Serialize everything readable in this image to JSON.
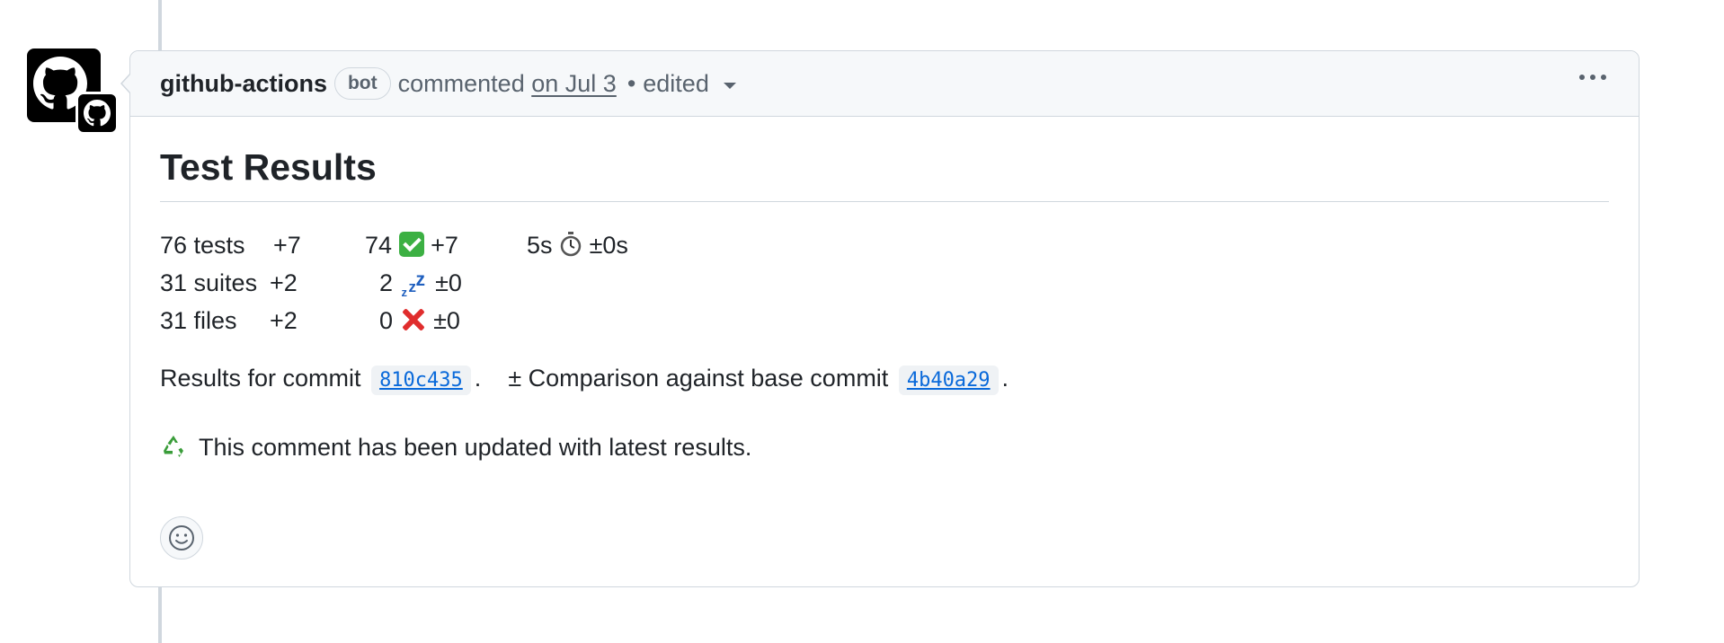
{
  "comment": {
    "author": "github-actions",
    "bot_label": "bot",
    "action_text": "commented",
    "timestamp": "on Jul 3",
    "separator": "•",
    "edited_text": "edited"
  },
  "body": {
    "heading": "Test Results",
    "stats": {
      "rows": [
        {
          "label": "76 tests",
          "delta": "+7",
          "count": "74",
          "icon": "check-mark-icon",
          "count_delta": "+7"
        },
        {
          "label": "31 suites",
          "delta": "+2",
          "count": "2",
          "icon": "sleeping-zzz-icon",
          "count_delta": "±0"
        },
        {
          "label": "31 files",
          "delta": "+2",
          "count": "0",
          "icon": "cross-mark-icon",
          "count_delta": "±0"
        }
      ],
      "duration": "5s",
      "duration_icon": "stopwatch-icon",
      "duration_delta": "±0s"
    },
    "results_prefix": "Results for commit",
    "commit": "810c435",
    "period1": ".",
    "comparison_text": "± Comparison against base commit",
    "base_commit": "4b40a29",
    "period2": ".",
    "updated_icon": "recycle-icon",
    "updated_text": "This comment has been updated with latest results."
  },
  "colors": {
    "link": "#0969da",
    "border": "#d0d7de",
    "header_bg": "#f6f8fa",
    "check_green": "#3cb043",
    "cross_red": "#e02d2d"
  }
}
